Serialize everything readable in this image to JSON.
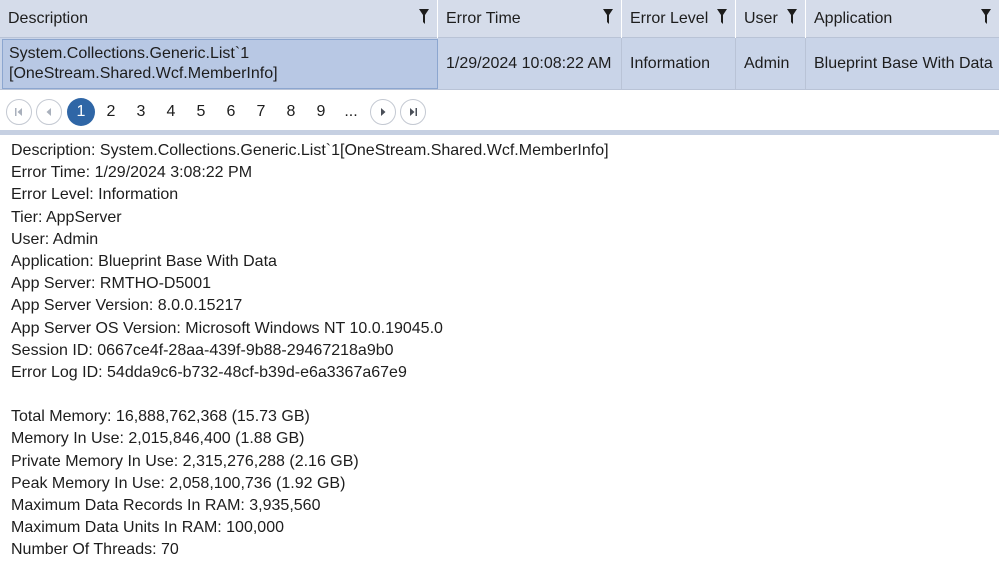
{
  "grid": {
    "columns": [
      {
        "label": "Description"
      },
      {
        "label": "Error Time"
      },
      {
        "label": "Error Level"
      },
      {
        "label": "User"
      },
      {
        "label": "Application"
      }
    ],
    "row": {
      "description_line1": "System.Collections.Generic.List`1",
      "description_line2": "[OneStream.Shared.Wcf.MemberInfo]",
      "error_time": "1/29/2024 10:08:22 AM",
      "error_level": "Information",
      "user": "Admin",
      "application": "Blueprint Base With Data"
    }
  },
  "pager": {
    "pages": [
      "1",
      "2",
      "3",
      "4",
      "5",
      "6",
      "7",
      "8",
      "9",
      "..."
    ],
    "active_page": "1"
  },
  "detail": {
    "lines_a": [
      "Description: System.Collections.Generic.List`1[OneStream.Shared.Wcf.MemberInfo]",
      "Error Time: 1/29/2024 3:08:22 PM",
      "Error Level: Information",
      "Tier: AppServer",
      "User: Admin",
      "Application: Blueprint Base With Data",
      "App Server: RMTHO-D5001",
      "App Server Version: 8.0.0.15217",
      "App Server OS Version: Microsoft Windows NT 10.0.19045.0",
      "Session ID: 0667ce4f-28aa-439f-9b88-29467218a9b0",
      "Error Log ID: 54dda9c6-b732-48cf-b39d-e6a3367a67e9"
    ],
    "lines_b": [
      "Total Memory: 16,888,762,368 (15.73 GB)",
      "Memory In Use: 2,015,846,400 (1.88 GB)",
      "Private Memory In Use: 2,315,276,288 (2.16 GB)",
      "Peak Memory In Use: 2,058,100,736 (1.92 GB)",
      "Maximum Data Records In RAM: 3,935,560",
      "Maximum Data Units In RAM: 100,000",
      "Number Of Threads: 70"
    ]
  },
  "colors": {
    "header_bg": "#d5dcea",
    "selected_row_bg": "#c9d4e8",
    "active_page": "#2f66a6"
  }
}
